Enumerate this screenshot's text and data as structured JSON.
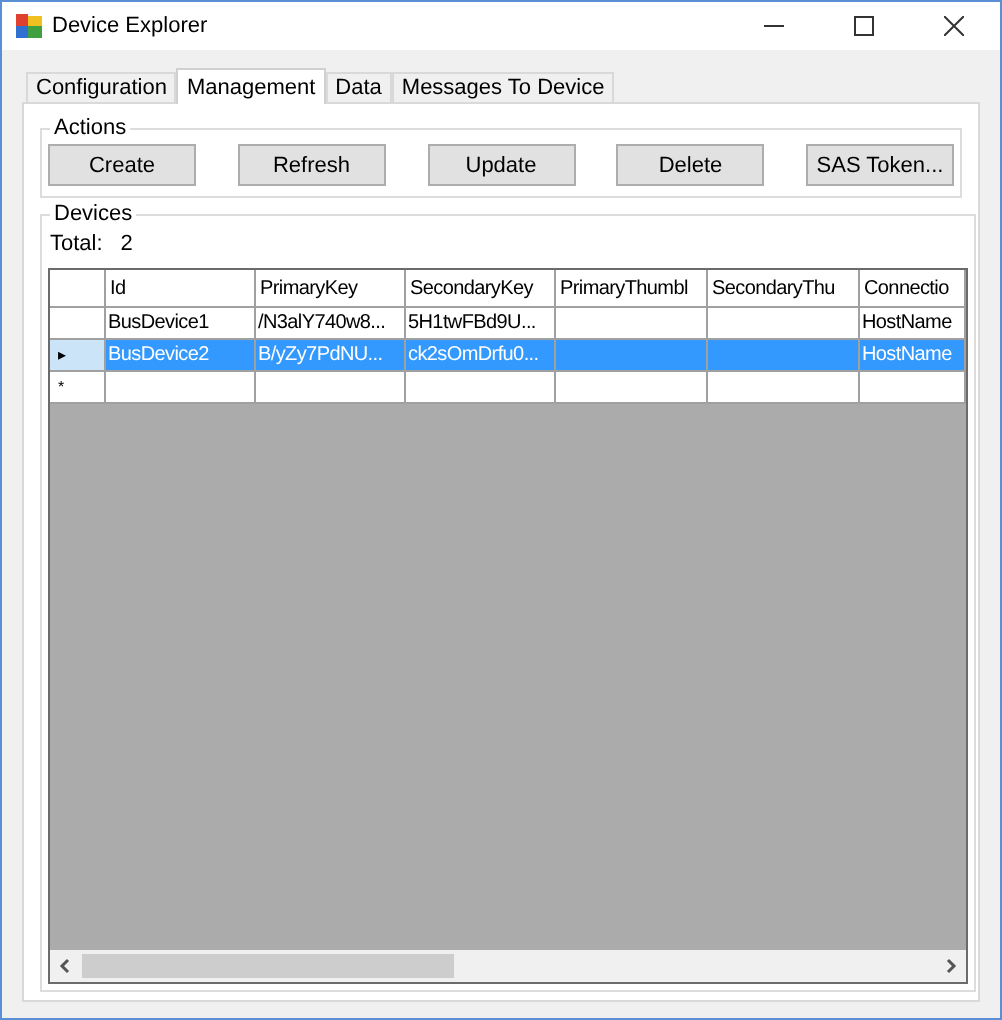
{
  "window": {
    "title": "Device Explorer"
  },
  "tabs": [
    {
      "label": "Configuration",
      "selected": false
    },
    {
      "label": "Management",
      "selected": true
    },
    {
      "label": "Data",
      "selected": false
    },
    {
      "label": "Messages To Device",
      "selected": false
    }
  ],
  "actions": {
    "title": "Actions",
    "buttons": [
      "Create",
      "Refresh",
      "Update",
      "Delete",
      "SAS Token..."
    ]
  },
  "devices": {
    "title": "Devices",
    "total_label": "Total:",
    "total": "2",
    "table": {
      "columns": [
        "Id",
        "PrimaryKey",
        "SecondaryKey",
        "PrimaryThumbl",
        "SecondaryThu",
        "Connectio"
      ],
      "rows": [
        {
          "marker": "",
          "selected": false,
          "cells": [
            "BusDevice1",
            "/N3alY740w8...",
            "5H1twFBd9U...",
            "",
            "",
            "HostName"
          ]
        },
        {
          "marker": "▸",
          "selected": true,
          "cells": [
            "BusDevice2",
            "B/yZy7PdNU...",
            "ck2sOmDrfu0...",
            "",
            "",
            "HostName"
          ]
        },
        {
          "marker": "*",
          "selected": false,
          "cells": [
            "",
            "",
            "",
            "",
            "",
            ""
          ]
        }
      ]
    }
  }
}
